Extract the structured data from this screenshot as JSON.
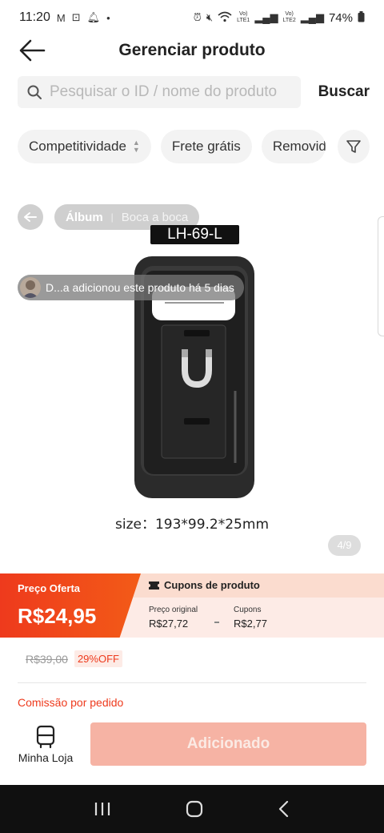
{
  "status_bar": {
    "time": "11:20",
    "battery": "74%",
    "sim1": "LTE1",
    "sim2": "LTE2"
  },
  "header": {
    "title": "Gerenciar produto"
  },
  "search": {
    "placeholder": "Pesquisar o ID / nome do produto",
    "button_label": "Buscar"
  },
  "filters": {
    "competitiveness": "Competitividade",
    "free_shipping": "Frete grátis",
    "removed": "Removido"
  },
  "gallery": {
    "tabs": [
      "Álbum",
      "Boca a boca"
    ],
    "model_label": "LH-69-L",
    "added_by_text": "D...a adicionou este produto há 5 dias",
    "size_caption": "size：193*99.2*25mm",
    "page_counter": "4/9"
  },
  "price": {
    "offer_label": "Preço Oferta",
    "offer_value": "R$24,95",
    "coupons_title": "Cupons de produto",
    "original_label": "Preço original",
    "original_value": "R$27,72",
    "coupons_label": "Cupons",
    "coupons_value": "R$2,77",
    "old_price": "R$39,00",
    "discount": "29%OFF",
    "commission_label": "Comissão por pedido"
  },
  "actions": {
    "my_store_label": "Minha Loja",
    "added_label": "Adicionado"
  },
  "colors": {
    "accent": "#ee3a1d",
    "added_button": "#f6b3a4"
  }
}
